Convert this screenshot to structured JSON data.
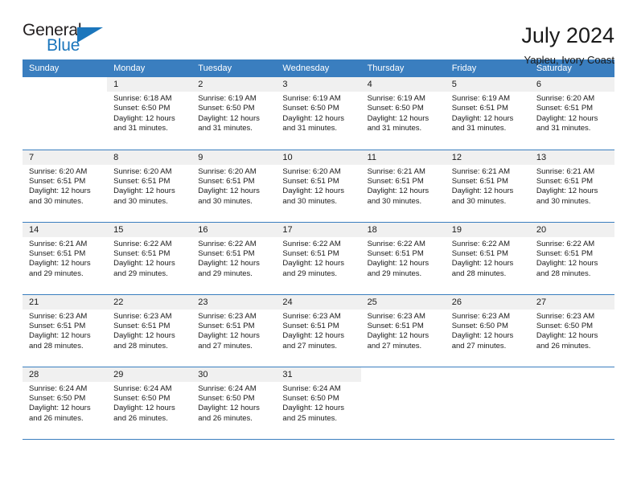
{
  "logo": {
    "word_top": "General",
    "word_bottom": "Blue",
    "accent_color": "#1b76bc"
  },
  "header": {
    "title": "July 2024",
    "subtitle": "Yapleu, Ivory Coast",
    "header_bg_color": "#3a7ebf"
  },
  "weekdays": [
    "Sunday",
    "Monday",
    "Tuesday",
    "Wednesday",
    "Thursday",
    "Friday",
    "Saturday"
  ],
  "weeks": [
    [
      {
        "day": "",
        "sunrise": "",
        "sunset": "",
        "daylight1": "",
        "daylight2": ""
      },
      {
        "day": "1",
        "sunrise": "Sunrise: 6:18 AM",
        "sunset": "Sunset: 6:50 PM",
        "daylight1": "Daylight: 12 hours",
        "daylight2": "and 31 minutes."
      },
      {
        "day": "2",
        "sunrise": "Sunrise: 6:19 AM",
        "sunset": "Sunset: 6:50 PM",
        "daylight1": "Daylight: 12 hours",
        "daylight2": "and 31 minutes."
      },
      {
        "day": "3",
        "sunrise": "Sunrise: 6:19 AM",
        "sunset": "Sunset: 6:50 PM",
        "daylight1": "Daylight: 12 hours",
        "daylight2": "and 31 minutes."
      },
      {
        "day": "4",
        "sunrise": "Sunrise: 6:19 AM",
        "sunset": "Sunset: 6:50 PM",
        "daylight1": "Daylight: 12 hours",
        "daylight2": "and 31 minutes."
      },
      {
        "day": "5",
        "sunrise": "Sunrise: 6:19 AM",
        "sunset": "Sunset: 6:51 PM",
        "daylight1": "Daylight: 12 hours",
        "daylight2": "and 31 minutes."
      },
      {
        "day": "6",
        "sunrise": "Sunrise: 6:20 AM",
        "sunset": "Sunset: 6:51 PM",
        "daylight1": "Daylight: 12 hours",
        "daylight2": "and 31 minutes."
      }
    ],
    [
      {
        "day": "7",
        "sunrise": "Sunrise: 6:20 AM",
        "sunset": "Sunset: 6:51 PM",
        "daylight1": "Daylight: 12 hours",
        "daylight2": "and 30 minutes."
      },
      {
        "day": "8",
        "sunrise": "Sunrise: 6:20 AM",
        "sunset": "Sunset: 6:51 PM",
        "daylight1": "Daylight: 12 hours",
        "daylight2": "and 30 minutes."
      },
      {
        "day": "9",
        "sunrise": "Sunrise: 6:20 AM",
        "sunset": "Sunset: 6:51 PM",
        "daylight1": "Daylight: 12 hours",
        "daylight2": "and 30 minutes."
      },
      {
        "day": "10",
        "sunrise": "Sunrise: 6:20 AM",
        "sunset": "Sunset: 6:51 PM",
        "daylight1": "Daylight: 12 hours",
        "daylight2": "and 30 minutes."
      },
      {
        "day": "11",
        "sunrise": "Sunrise: 6:21 AM",
        "sunset": "Sunset: 6:51 PM",
        "daylight1": "Daylight: 12 hours",
        "daylight2": "and 30 minutes."
      },
      {
        "day": "12",
        "sunrise": "Sunrise: 6:21 AM",
        "sunset": "Sunset: 6:51 PM",
        "daylight1": "Daylight: 12 hours",
        "daylight2": "and 30 minutes."
      },
      {
        "day": "13",
        "sunrise": "Sunrise: 6:21 AM",
        "sunset": "Sunset: 6:51 PM",
        "daylight1": "Daylight: 12 hours",
        "daylight2": "and 30 minutes."
      }
    ],
    [
      {
        "day": "14",
        "sunrise": "Sunrise: 6:21 AM",
        "sunset": "Sunset: 6:51 PM",
        "daylight1": "Daylight: 12 hours",
        "daylight2": "and 29 minutes."
      },
      {
        "day": "15",
        "sunrise": "Sunrise: 6:22 AM",
        "sunset": "Sunset: 6:51 PM",
        "daylight1": "Daylight: 12 hours",
        "daylight2": "and 29 minutes."
      },
      {
        "day": "16",
        "sunrise": "Sunrise: 6:22 AM",
        "sunset": "Sunset: 6:51 PM",
        "daylight1": "Daylight: 12 hours",
        "daylight2": "and 29 minutes."
      },
      {
        "day": "17",
        "sunrise": "Sunrise: 6:22 AM",
        "sunset": "Sunset: 6:51 PM",
        "daylight1": "Daylight: 12 hours",
        "daylight2": "and 29 minutes."
      },
      {
        "day": "18",
        "sunrise": "Sunrise: 6:22 AM",
        "sunset": "Sunset: 6:51 PM",
        "daylight1": "Daylight: 12 hours",
        "daylight2": "and 29 minutes."
      },
      {
        "day": "19",
        "sunrise": "Sunrise: 6:22 AM",
        "sunset": "Sunset: 6:51 PM",
        "daylight1": "Daylight: 12 hours",
        "daylight2": "and 28 minutes."
      },
      {
        "day": "20",
        "sunrise": "Sunrise: 6:22 AM",
        "sunset": "Sunset: 6:51 PM",
        "daylight1": "Daylight: 12 hours",
        "daylight2": "and 28 minutes."
      }
    ],
    [
      {
        "day": "21",
        "sunrise": "Sunrise: 6:23 AM",
        "sunset": "Sunset: 6:51 PM",
        "daylight1": "Daylight: 12 hours",
        "daylight2": "and 28 minutes."
      },
      {
        "day": "22",
        "sunrise": "Sunrise: 6:23 AM",
        "sunset": "Sunset: 6:51 PM",
        "daylight1": "Daylight: 12 hours",
        "daylight2": "and 28 minutes."
      },
      {
        "day": "23",
        "sunrise": "Sunrise: 6:23 AM",
        "sunset": "Sunset: 6:51 PM",
        "daylight1": "Daylight: 12 hours",
        "daylight2": "and 27 minutes."
      },
      {
        "day": "24",
        "sunrise": "Sunrise: 6:23 AM",
        "sunset": "Sunset: 6:51 PM",
        "daylight1": "Daylight: 12 hours",
        "daylight2": "and 27 minutes."
      },
      {
        "day": "25",
        "sunrise": "Sunrise: 6:23 AM",
        "sunset": "Sunset: 6:51 PM",
        "daylight1": "Daylight: 12 hours",
        "daylight2": "and 27 minutes."
      },
      {
        "day": "26",
        "sunrise": "Sunrise: 6:23 AM",
        "sunset": "Sunset: 6:50 PM",
        "daylight1": "Daylight: 12 hours",
        "daylight2": "and 27 minutes."
      },
      {
        "day": "27",
        "sunrise": "Sunrise: 6:23 AM",
        "sunset": "Sunset: 6:50 PM",
        "daylight1": "Daylight: 12 hours",
        "daylight2": "and 26 minutes."
      }
    ],
    [
      {
        "day": "28",
        "sunrise": "Sunrise: 6:24 AM",
        "sunset": "Sunset: 6:50 PM",
        "daylight1": "Daylight: 12 hours",
        "daylight2": "and 26 minutes."
      },
      {
        "day": "29",
        "sunrise": "Sunrise: 6:24 AM",
        "sunset": "Sunset: 6:50 PM",
        "daylight1": "Daylight: 12 hours",
        "daylight2": "and 26 minutes."
      },
      {
        "day": "30",
        "sunrise": "Sunrise: 6:24 AM",
        "sunset": "Sunset: 6:50 PM",
        "daylight1": "Daylight: 12 hours",
        "daylight2": "and 26 minutes."
      },
      {
        "day": "31",
        "sunrise": "Sunrise: 6:24 AM",
        "sunset": "Sunset: 6:50 PM",
        "daylight1": "Daylight: 12 hours",
        "daylight2": "and 25 minutes."
      },
      {
        "day": "",
        "sunrise": "",
        "sunset": "",
        "daylight1": "",
        "daylight2": ""
      },
      {
        "day": "",
        "sunrise": "",
        "sunset": "",
        "daylight1": "",
        "daylight2": ""
      },
      {
        "day": "",
        "sunrise": "",
        "sunset": "",
        "daylight1": "",
        "daylight2": ""
      }
    ]
  ]
}
